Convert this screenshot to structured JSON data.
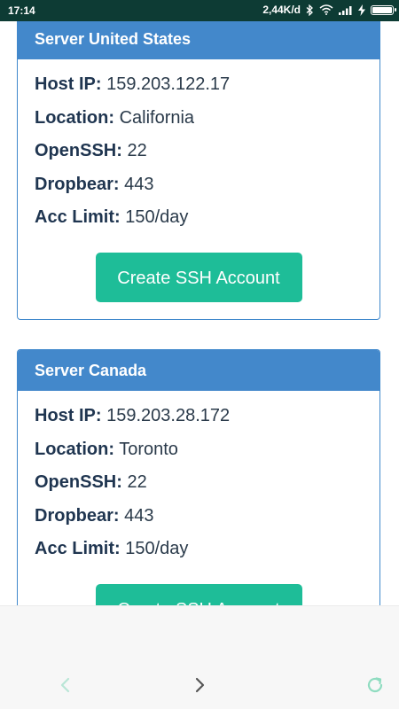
{
  "status_bar": {
    "time": "17:14",
    "speed": "2,44K/d",
    "icons": [
      "bluetooth-icon",
      "wifi-icon",
      "signal-icon",
      "charging-icon",
      "battery-icon"
    ],
    "battery_level": 0.9
  },
  "servers": [
    {
      "title": "Server United States",
      "fields": [
        {
          "label": "Host IP:",
          "value": "159.203.122.17"
        },
        {
          "label": "Location:",
          "value": "California"
        },
        {
          "label": "OpenSSH:",
          "value": "22"
        },
        {
          "label": "Dropbear:",
          "value": "443"
        },
        {
          "label": "Acc Limit:",
          "value": "150/day"
        }
      ],
      "button_label": "Create SSH Account"
    },
    {
      "title": "Server Canada",
      "fields": [
        {
          "label": "Host IP:",
          "value": "159.203.28.172"
        },
        {
          "label": "Location:",
          "value": "Toronto"
        },
        {
          "label": "OpenSSH:",
          "value": "22"
        },
        {
          "label": "Dropbear:",
          "value": "443"
        },
        {
          "label": "Acc Limit:",
          "value": "150/day"
        }
      ],
      "button_label": "Create SSH Account"
    }
  ],
  "browser_nav": {
    "icons": [
      "back-icon",
      "forward-icon",
      "refresh-icon"
    ]
  },
  "colors": {
    "status_bar": "#0d3b34",
    "card_header": "#4388cb",
    "button": "#1ebd98",
    "nav_back_disabled": "#b9e6d6",
    "nav_forward": "#555555",
    "nav_refresh": "#8fdcc0"
  }
}
